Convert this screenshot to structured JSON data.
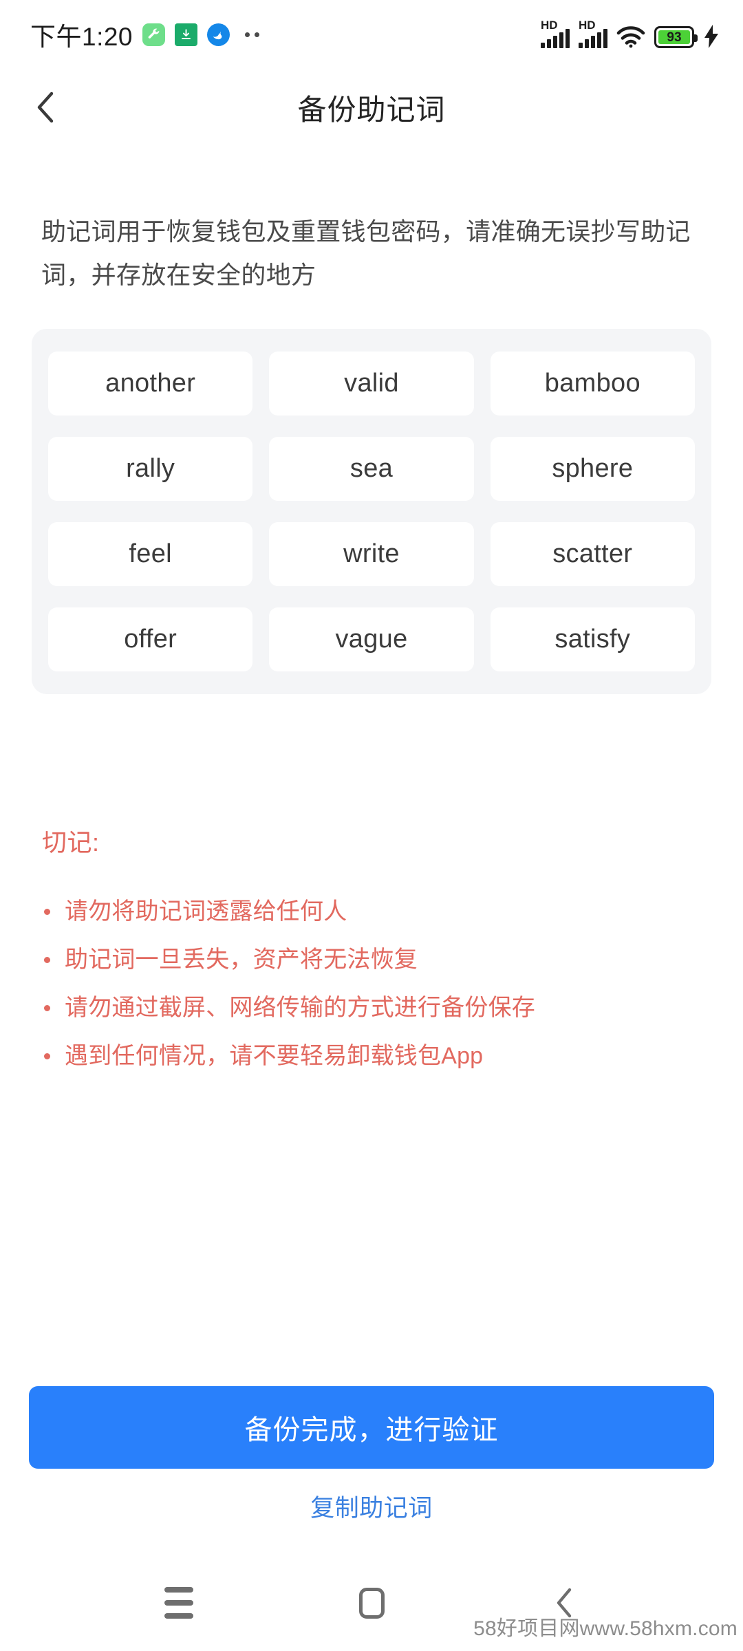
{
  "status_bar": {
    "time": "下午1:20",
    "app_icons": [
      "wrench-icon",
      "download-icon",
      "bird-icon"
    ],
    "overflow_dots": "··",
    "signal_labels": [
      "HD",
      "HD"
    ],
    "wifi": "wifi-icon",
    "battery_percent": "93",
    "battery_color": "#4cd137",
    "charging": "charging-bolt-icon"
  },
  "app_bar": {
    "back_icon": "chevron-left-icon",
    "title": "备份助记词"
  },
  "description": "助记词用于恢复钱包及重置钱包密码，请准确无误抄写助记词，并存放在安全的地方",
  "mnemonic": {
    "words": [
      "another",
      "valid",
      "bamboo",
      "rally",
      "sea",
      "sphere",
      "feel",
      "write",
      "scatter",
      "offer",
      "vague",
      "satisfy"
    ]
  },
  "warnings": {
    "title": "切记:",
    "color": "#e2695f",
    "items": [
      "请勿将助记词透露给任何人",
      "助记词一旦丢失，资产将无法恢复",
      "请勿通过截屏、网络传输的方式进行备份保存",
      "遇到任何情况，请不要轻易卸载钱包App"
    ]
  },
  "actions": {
    "primary_label": "备份完成，进行验证",
    "primary_color": "#2980fb",
    "copy_label": "复制助记词",
    "copy_color": "#3a80e0"
  },
  "nav_bar": {
    "recents": "hamburger-icon",
    "home": "square-icon",
    "back": "chevron-left-icon"
  },
  "watermark": "58好项目网www.58hxm.com"
}
